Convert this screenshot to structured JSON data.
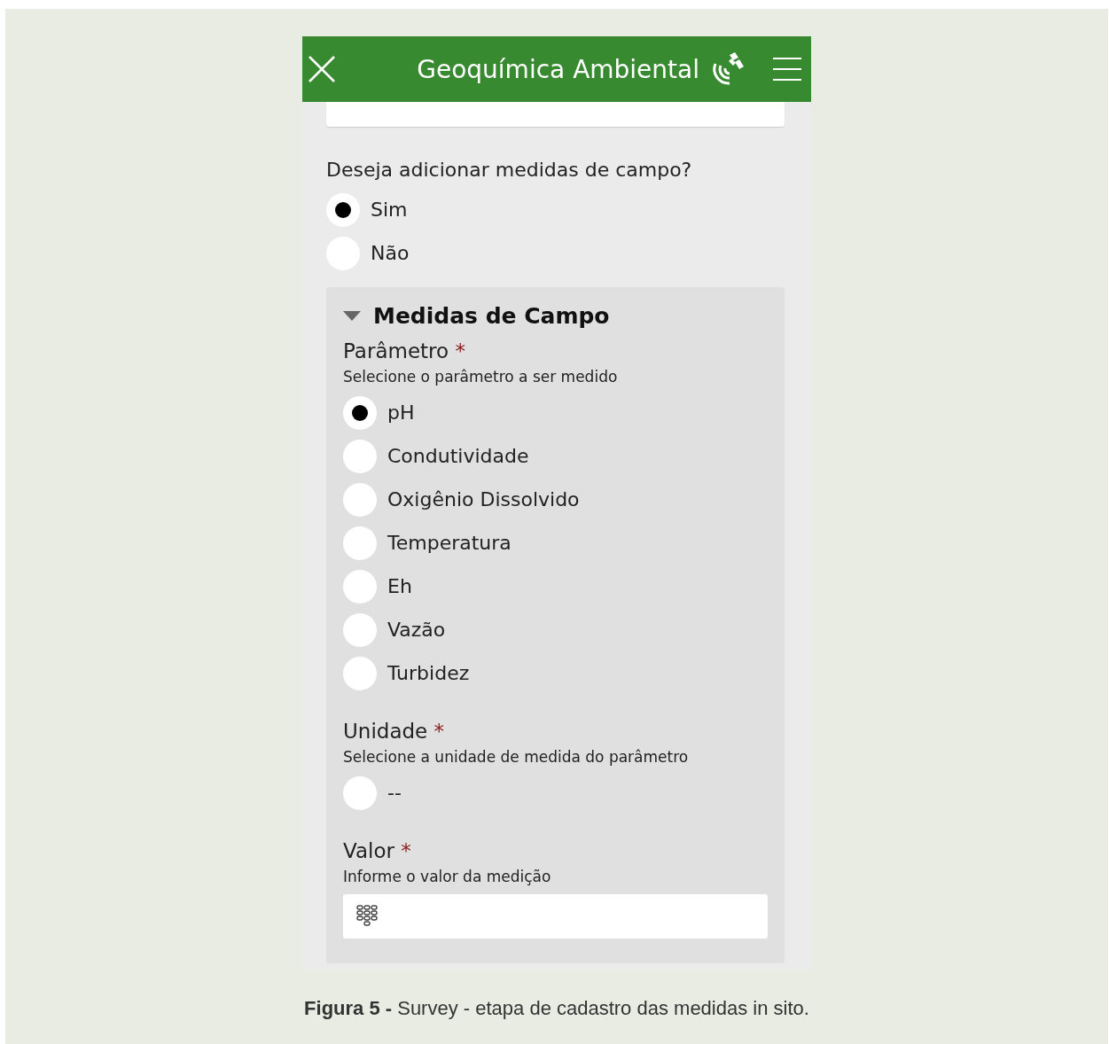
{
  "header": {
    "title": "Geoquímica Ambiental"
  },
  "question": {
    "label": "Deseja adicionar medidas de campo?",
    "options": [
      {
        "label": "Sim",
        "selected": true
      },
      {
        "label": "Não",
        "selected": false
      }
    ]
  },
  "section": {
    "title": "Medidas de Campo",
    "expanded": true,
    "fields": [
      {
        "kind": "radio",
        "label": "Parâmetro",
        "required": "*",
        "hint": "Selecione o parâmetro a ser medido",
        "options": [
          {
            "label": "pH",
            "selected": true
          },
          {
            "label": "Condutividade",
            "selected": false
          },
          {
            "label": "Oxigênio Dissolvido",
            "selected": false
          },
          {
            "label": "Temperatura",
            "selected": false
          },
          {
            "label": "Eh",
            "selected": false
          },
          {
            "label": "Vazão",
            "selected": false
          },
          {
            "label": "Turbidez",
            "selected": false
          }
        ]
      },
      {
        "kind": "radio",
        "label": "Unidade",
        "required": "*",
        "hint": "Selecione a unidade de medida do parâmetro",
        "options": [
          {
            "label": "--",
            "selected": false
          }
        ]
      },
      {
        "kind": "number",
        "label": "Valor",
        "required": "*",
        "hint": "Informe o valor da medição"
      }
    ]
  },
  "caption": "**Figura 5 -** Survey - etapa de cadastro das medidas in sito."
}
